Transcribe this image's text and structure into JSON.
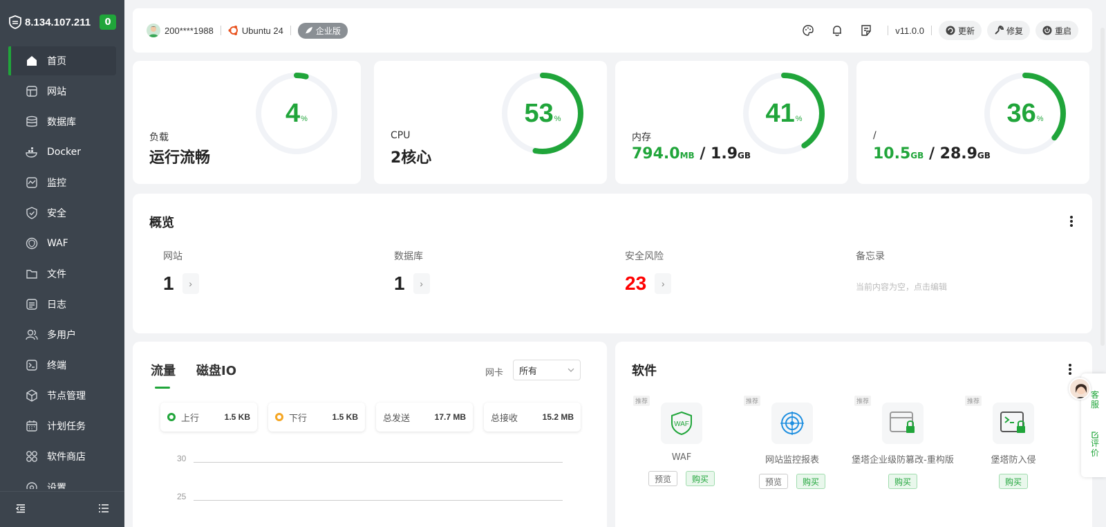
{
  "sidebar": {
    "ip": "8.134.107.211",
    "badge": "0",
    "items": [
      {
        "label": "首页",
        "icon": "home-icon"
      },
      {
        "label": "网站",
        "icon": "website-icon"
      },
      {
        "label": "数据库",
        "icon": "database-icon"
      },
      {
        "label": "Docker",
        "icon": "docker-icon"
      },
      {
        "label": "监控",
        "icon": "monitor-icon"
      },
      {
        "label": "安全",
        "icon": "shield-icon"
      },
      {
        "label": "WAF",
        "icon": "waf-icon"
      },
      {
        "label": "文件",
        "icon": "folder-icon"
      },
      {
        "label": "日志",
        "icon": "log-icon"
      },
      {
        "label": "多用户",
        "icon": "users-icon"
      },
      {
        "label": "终端",
        "icon": "terminal-icon"
      },
      {
        "label": "节点管理",
        "icon": "node-icon"
      },
      {
        "label": "计划任务",
        "icon": "calendar-icon"
      },
      {
        "label": "软件商店",
        "icon": "store-icon"
      },
      {
        "label": "设置",
        "icon": "gear-icon"
      }
    ]
  },
  "topbar": {
    "user": "200****1988",
    "os": "Ubuntu 24",
    "edition": "企业版",
    "version": "v11.0.0",
    "update_label": "更新",
    "repair_label": "修复",
    "restart_label": "重启"
  },
  "stats": {
    "load": {
      "label": "负载",
      "value": "运行流畅",
      "percent": "4",
      "unit": "%",
      "fraction": 0.04
    },
    "cpu": {
      "label": "CPU",
      "value": "2核心",
      "percent": "53",
      "unit": "%",
      "fraction": 0.53
    },
    "memory": {
      "label": "内存",
      "used": "794.0",
      "used_unit": "MB",
      "sep": " / ",
      "total": "1.9",
      "total_unit": "GB",
      "percent": "41",
      "unit": "%",
      "fraction": 0.41
    },
    "disk": {
      "label": "/",
      "used": "10.5",
      "used_unit": "GB",
      "sep": " / ",
      "total": "28.9",
      "total_unit": "GB",
      "percent": "36",
      "unit": "%",
      "fraction": 0.36
    }
  },
  "overview": {
    "title": "概览",
    "items": [
      {
        "label": "网站",
        "value": "1",
        "arrow": "›"
      },
      {
        "label": "数据库",
        "value": "1",
        "arrow": "›"
      },
      {
        "label": "安全风险",
        "value": "23",
        "arrow": "›"
      },
      {
        "label": "备忘录",
        "value": "当前内容为空，点击编辑"
      }
    ]
  },
  "traffic": {
    "tabs": [
      "流量",
      "磁盘IO"
    ],
    "nic_label": "网卡",
    "nic_value": "所有",
    "up_label": "上行",
    "up_value": "1.5 KB",
    "down_label": "下行",
    "down_value": "1.5 KB",
    "sent_label": "总发送",
    "sent_value": "17.7 MB",
    "recv_label": "总接收",
    "recv_value": "15.2 MB",
    "y_ticks": [
      "30",
      "25"
    ]
  },
  "software": {
    "title": "软件",
    "tag": "推荐",
    "preview_label": "预览",
    "buy_label": "购买",
    "items": [
      {
        "name": "WAF",
        "icon_text": "WAF"
      },
      {
        "name": "网站监控报表"
      },
      {
        "name": "堡塔企业级防篡改-重构版"
      },
      {
        "name": "堡塔防入侵"
      }
    ]
  },
  "floater": {
    "service": "客服",
    "review": "评价"
  },
  "colors": {
    "accent": "#20a53a",
    "danger": "#ff0000",
    "sidebar": "#3c444d"
  }
}
